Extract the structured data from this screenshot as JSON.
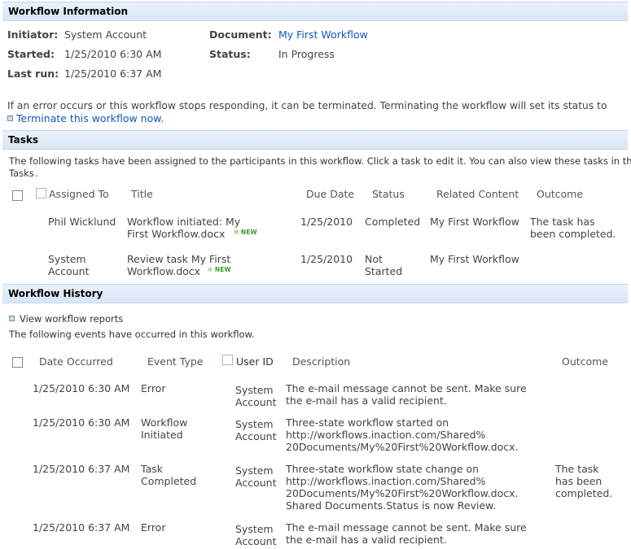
{
  "workflow_info": {
    "header": "Workflow Information",
    "initiator_label": "Initiator:",
    "initiator": "System Account",
    "document_label": "Document:",
    "document": "My First Workflow",
    "started_label": "Started:",
    "started": "1/25/2010 6:30 AM",
    "status_label": "Status:",
    "status": "In Progress",
    "lastrun_label": "Last run:",
    "lastrun": "1/25/2010 6:37 AM",
    "error_text": "If an error occurs or this workflow stops responding, it can be terminated. Terminating the workflow will set its status to",
    "terminate_link": "Terminate this workflow now."
  },
  "tasks": {
    "header": "Tasks",
    "intro": "The following tasks have been assigned to the participants in this workflow. Click a task to edit it. You can also view these tasks in the list",
    "tasks_link": "Tasks",
    "columns": [
      "Assigned To",
      "Title",
      "Due Date",
      "Status",
      "Related Content",
      "Outcome"
    ],
    "rows": [
      {
        "assigned": [
          "Phil Wicklund"
        ],
        "title": [
          "Workflow initiated: My",
          "First Workflow.docx"
        ],
        "due": "1/25/2010",
        "status": [
          "Completed"
        ],
        "related": "My First Workflow",
        "outcome": [
          "The task has",
          "been completed."
        ]
      },
      {
        "assigned": [
          "System",
          "Account"
        ],
        "title": [
          "Review task My First",
          "Workflow.docx"
        ],
        "due": "1/25/2010",
        "status": [
          "Not",
          "Started"
        ],
        "related": "My First Workflow",
        "outcome": []
      }
    ],
    "new_badge": "NEW"
  },
  "history": {
    "header": "Workflow History",
    "reports_link": "View workflow reports",
    "intro": "The following events have occurred in this workflow.",
    "columns": [
      "Date Occurred",
      "Event Type",
      "User ID",
      "Description",
      "Outcome"
    ],
    "rows": [
      {
        "date": "1/25/2010 6:30 AM",
        "event": [
          "Error"
        ],
        "user": [
          "System",
          "Account"
        ],
        "desc": [
          {
            "t": "The e-mail message cannot be sent. Make sure",
            "link": false
          },
          {
            "t": "the e-mail has a valid recipient.",
            "link": false
          }
        ],
        "outcome": []
      },
      {
        "date": "1/25/2010 6:30 AM",
        "event": [
          "Workflow",
          "Initiated"
        ],
        "user": [
          "System",
          "Account"
        ],
        "desc": [
          {
            "t": "Three-state workflow started on",
            "link": false
          },
          {
            "t": "http://workflows.inaction.com/Shared%",
            "link": true
          },
          {
            "t": "20Documents/My%20First%20Workflow.docx.",
            "link": true
          }
        ],
        "outcome": []
      },
      {
        "date": "1/25/2010 6:37 AM",
        "event": [
          "Task",
          "Completed"
        ],
        "user": [
          "System",
          "Account"
        ],
        "desc": [
          {
            "t": "Three-state workflow state change on",
            "link": false
          },
          {
            "t": "http://workflows.inaction.com/Shared%",
            "link": true
          },
          {
            "t": "20Documents/My%20First%20Workflow.docx.",
            "link": true
          },
          {
            "t": "Shared Documents.Status is now Review.",
            "link": false
          }
        ],
        "outcome": [
          "The task",
          "has been",
          "completed."
        ]
      },
      {
        "date": "1/25/2010 6:37 AM",
        "event": [
          "Error"
        ],
        "user": [
          "System",
          "Account"
        ],
        "desc": [
          {
            "t": "The e-mail message cannot be sent. Make sure",
            "link": false
          },
          {
            "t": "the e-mail has a valid recipient.",
            "link": false
          }
        ],
        "outcome": []
      }
    ]
  }
}
